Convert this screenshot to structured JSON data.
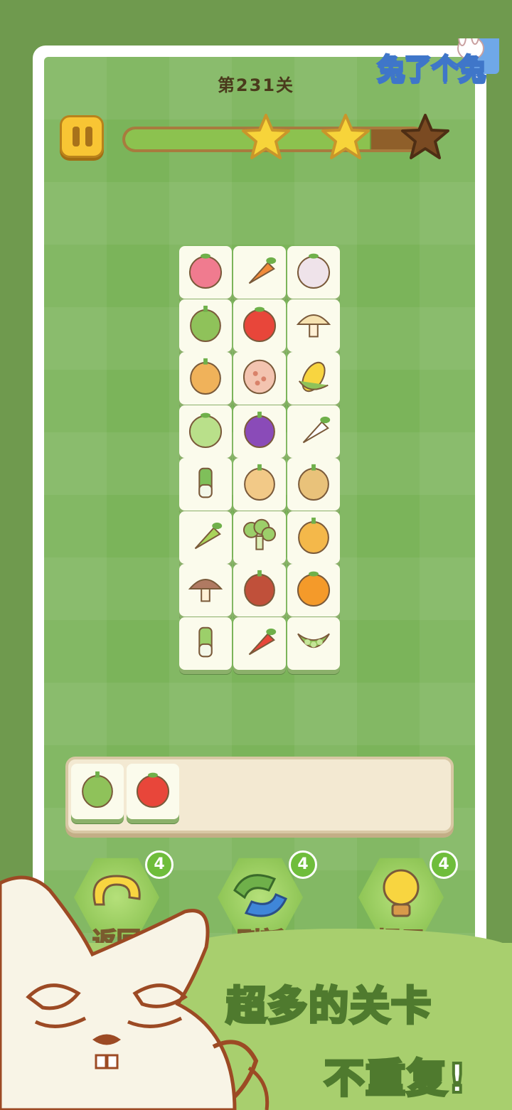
{
  "header": {
    "level_title": "第231关",
    "logo_text": "兔了个兔",
    "progress_fraction": 0.82,
    "stars": [
      {
        "name": "star-1",
        "earned": true
      },
      {
        "name": "star-2",
        "earned": true
      },
      {
        "name": "star-3",
        "earned": false
      }
    ]
  },
  "board": {
    "columns": 3,
    "tiles": [
      [
        "onion-icon",
        "carrot-icon",
        "garlic-icon"
      ],
      [
        "green-pepper-icon",
        "tomato-icon",
        "mushroom-icon"
      ],
      [
        "ginger-icon",
        "lotus-root-icon",
        "corn-icon"
      ],
      [
        "cabbage-icon",
        "eggplant-icon",
        "daikon-radish-icon"
      ],
      [
        "leek-icon",
        "peanut-icon",
        "potato-icon"
      ],
      [
        "cucumber-icon",
        "broccoli-icon",
        "bell-pepper-icon"
      ],
      [
        "shiitake-icon",
        "sweet-potato-icon",
        "pumpkin-icon"
      ],
      [
        "bok-choy-icon",
        "strawberry-icon",
        "pea-pod-icon"
      ]
    ]
  },
  "tray": {
    "slots": [
      "green-pepper-icon",
      "tomato-icon"
    ]
  },
  "powerups": [
    {
      "label": "返回",
      "count": "4",
      "icon": "undo-arrow-icon"
    },
    {
      "label": "刷新",
      "count": "4",
      "icon": "shuffle-arrows-icon"
    },
    {
      "label": "提示",
      "count": "4",
      "icon": "lightbulb-icon"
    }
  ],
  "banner": {
    "line1": "超多的关卡",
    "line2": "不重复!"
  },
  "colors": {
    "background": "#6f9a4e",
    "board": "#7bb45a",
    "progress": "#8cc24f",
    "star_earned": "#f7d43a",
    "star_empty": "#7a4a22"
  }
}
